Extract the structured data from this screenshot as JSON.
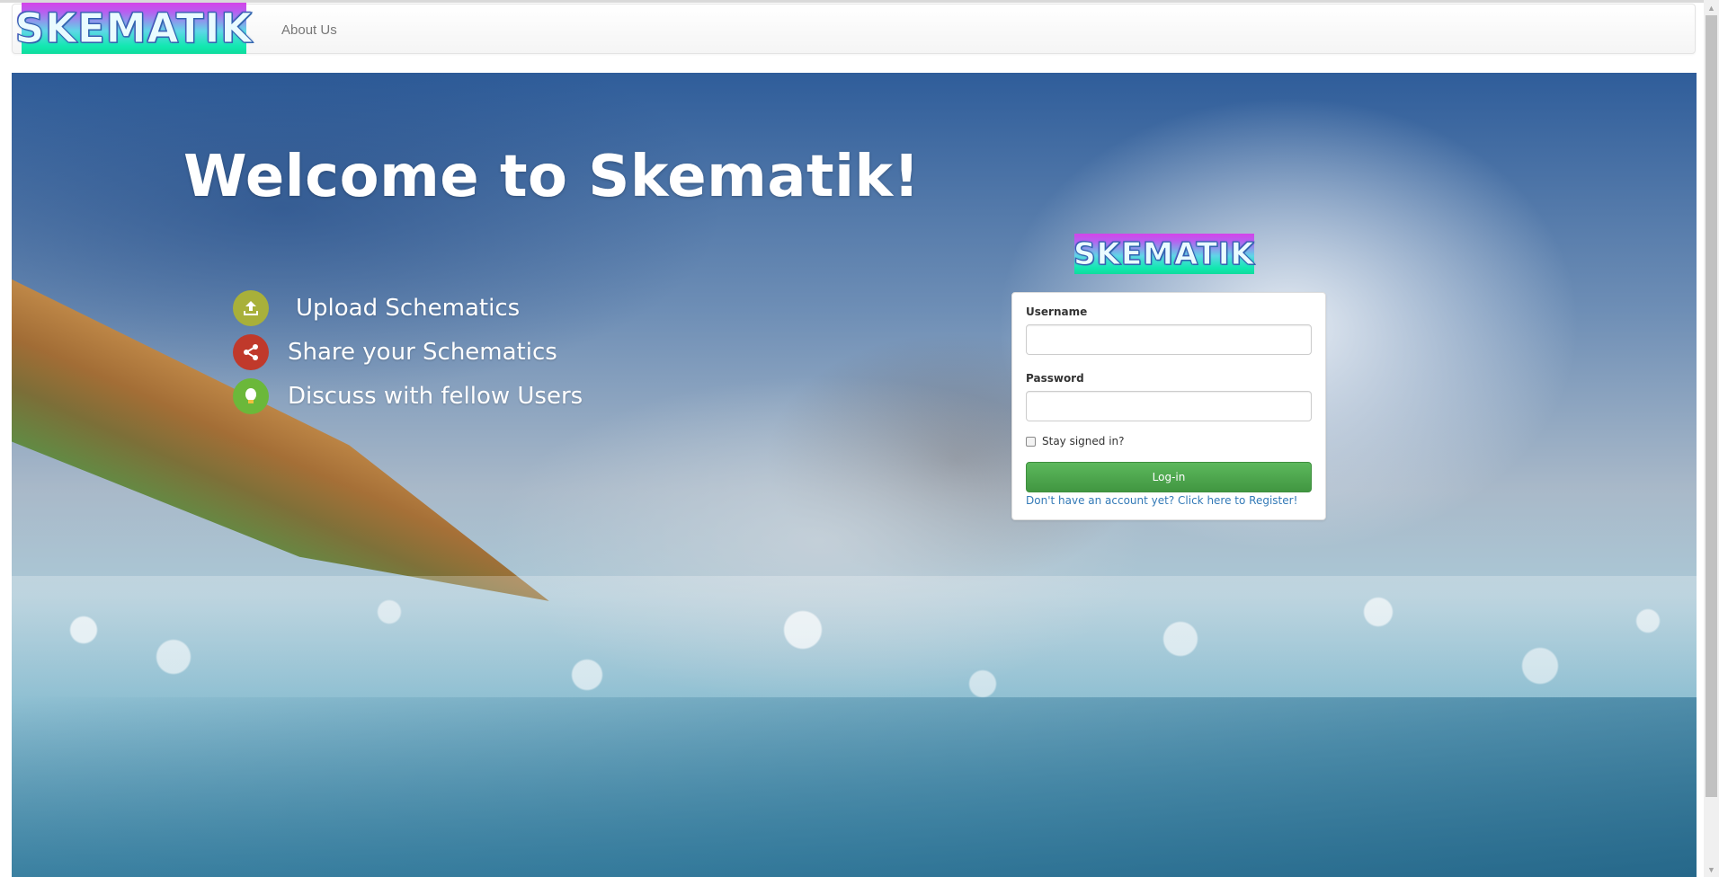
{
  "nav": {
    "logo_text": "SKEMATIK",
    "about_link": "About Us"
  },
  "hero": {
    "title": "Welcome to Skematik!",
    "features": [
      {
        "icon": "upload-icon",
        "color": "#a8b03a",
        "label": "Upload Schematics"
      },
      {
        "icon": "share-icon",
        "color": "#c0392b",
        "label": "Share your Schematics"
      },
      {
        "icon": "idea-bulb-icon",
        "color": "#6bb83a",
        "label": "Discuss with fellow Users"
      }
    ]
  },
  "login": {
    "logo_text": "SKEMATIK",
    "username_label": "Username",
    "username_value": "",
    "password_label": "Password",
    "password_value": "",
    "remember_label": "Stay signed in?",
    "remember_checked": false,
    "submit_label": "Log-in",
    "register_link": "Don't have an account yet? Click here to Register!"
  },
  "colors": {
    "login_button": "#449d44",
    "link": "#337ab7",
    "hero_text": "#ffffff"
  }
}
